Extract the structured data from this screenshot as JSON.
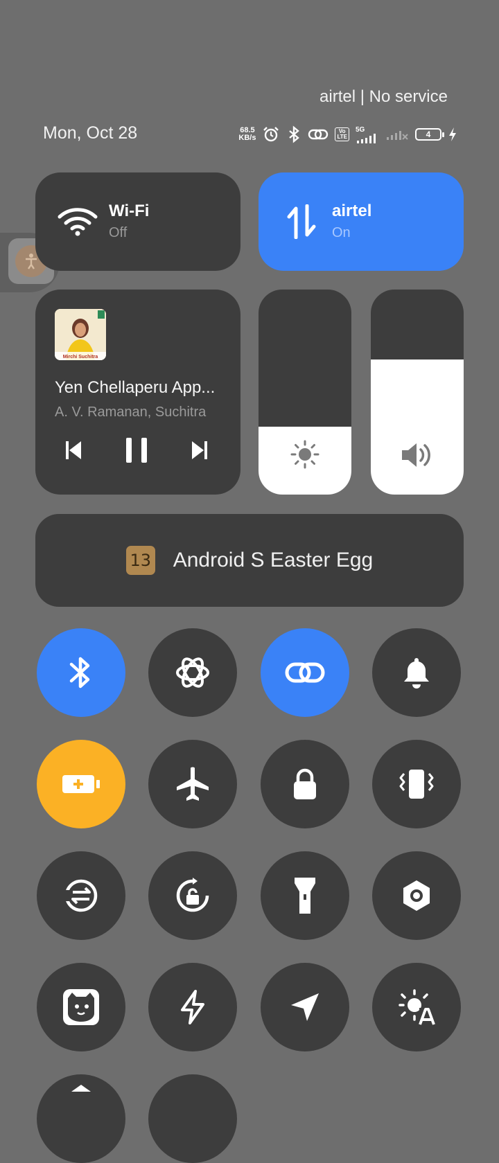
{
  "status_bar": {
    "carrier": "airtel | No service",
    "date": "Mon, Oct 28",
    "speed_value": "68.5",
    "speed_unit": "KB/s",
    "volte_line1": "Vo",
    "volte_line2": "LTE",
    "network_type": "5G",
    "battery_level": "4"
  },
  "wifi_tile": {
    "title": "Wi-Fi",
    "status": "Off",
    "icon": "wifi-icon"
  },
  "data_tile": {
    "title": "airtel",
    "status": "On",
    "icon": "mobile-data-icon",
    "color": "#3a82f7"
  },
  "media": {
    "album_art_text": "Mirchi Suchitra",
    "song_title": "Yen Chellaperu App...",
    "artist": "A. V. Ramanan, Suchitra",
    "controls": [
      "previous-icon",
      "pause-icon",
      "next-icon"
    ]
  },
  "brightness": {
    "level": 0.33,
    "icon": "brightness-icon"
  },
  "volume": {
    "level": 0.66,
    "icon": "volume-icon"
  },
  "easter_egg": {
    "icon_text": "13",
    "label": "Android S Easter Egg"
  },
  "toggles": [
    {
      "name": "bluetooth",
      "state": "on",
      "icon": "bluetooth-icon"
    },
    {
      "name": "chatgpt",
      "state": "off",
      "icon": "chatgpt-icon"
    },
    {
      "name": "hotspot-link",
      "state": "on",
      "icon": "link-icon"
    },
    {
      "name": "sound",
      "state": "off",
      "icon": "bell-icon"
    },
    {
      "name": "battery-saver",
      "state": "on",
      "icon": "battery-saver-icon"
    },
    {
      "name": "airplane-mode",
      "state": "off",
      "icon": "airplane-icon"
    },
    {
      "name": "lock-screen",
      "state": "off",
      "icon": "lock-icon"
    },
    {
      "name": "vibrate",
      "state": "off",
      "icon": "vibrate-icon"
    },
    {
      "name": "data-saver",
      "state": "off",
      "icon": "sync-icon"
    },
    {
      "name": "auto-rotate",
      "state": "off",
      "icon": "rotate-lock-icon"
    },
    {
      "name": "flashlight",
      "state": "off",
      "icon": "flashlight-icon"
    },
    {
      "name": "settings",
      "state": "off",
      "icon": "hexagon-icon"
    },
    {
      "name": "app-shortcut",
      "state": "off",
      "icon": "app-face-icon"
    },
    {
      "name": "power-mode",
      "state": "off",
      "icon": "lightning-icon"
    },
    {
      "name": "location",
      "state": "off",
      "icon": "location-icon"
    },
    {
      "name": "auto-brightness",
      "state": "off",
      "icon": "auto-brightness-icon"
    }
  ],
  "colors": {
    "active_blue": "#3a82f7",
    "active_yellow": "#fbb125",
    "tile_dark": "#3d3d3d",
    "background": "#6e6e6e"
  }
}
